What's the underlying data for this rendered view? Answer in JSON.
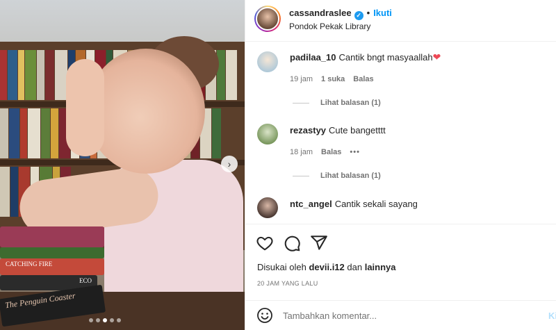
{
  "post": {
    "username": "cassandraslee",
    "follow_label": "Ikuti",
    "location": "Pondok Pekak Library"
  },
  "media": {
    "book_titles": [
      "CATCHING FIRE",
      "ECO",
      "The Penguin Coaster"
    ],
    "carousel_count": 5,
    "carousel_active": 3
  },
  "comments": [
    {
      "username": "padilaa_10",
      "text": "Cantik bngt masyaallah",
      "emoji": "heart-icon",
      "time": "19 jam",
      "likes": "1 suka",
      "reply": "Balas",
      "view_replies": "Lihat balasan (1)"
    },
    {
      "username": "rezastyy",
      "text": "Cute bangetttt",
      "time": "18 jam",
      "reply": "Balas",
      "more": "•••",
      "view_replies": "Lihat balasan (1)"
    },
    {
      "username": "ntc_angel",
      "text": "Cantik sekali sayang"
    }
  ],
  "actions": {
    "liked_prefix": "Disukai oleh",
    "liked_user": "devii.i12",
    "liked_mid": "dan",
    "liked_others": "lainnya",
    "time_ago": "20 JAM YANG LALU"
  },
  "composer": {
    "placeholder": "Tambahkan komentar...",
    "post_label": "Kirim"
  },
  "colors": {
    "accent": "#0095f6",
    "verified": "#1d9bf0",
    "heart": "#ed4956",
    "muted": "#737373"
  }
}
